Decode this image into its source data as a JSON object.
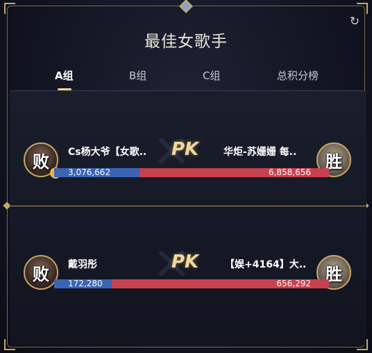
{
  "title": "最佳女歌手",
  "tabs": [
    {
      "label": "A组",
      "active": true
    },
    {
      "label": "B组",
      "active": false
    },
    {
      "label": "C组",
      "active": false
    },
    {
      "label": "总积分榜",
      "active": false
    }
  ],
  "icons": {
    "refresh": "refresh-icon"
  },
  "colors": {
    "accent_gold": "#c9a866",
    "left_bar": "#3b64b5",
    "right_bar": "#c8414e"
  },
  "matches": [
    {
      "left": {
        "name": "Cs杨大爷【女歌..",
        "score": "3,076,662",
        "badge": "败"
      },
      "right": {
        "name": "华炬-苏姗姗 每..",
        "score": "6,858,656",
        "badge": "胜"
      },
      "pk": "PK",
      "left_fraction": 0.31
    },
    {
      "left": {
        "name": "戴羽彤",
        "score": "172,280",
        "badge": "败"
      },
      "right": {
        "name": "【娱+4164】大..",
        "score": "656,292",
        "badge": "胜"
      },
      "pk": "PK",
      "left_fraction": 0.21
    }
  ]
}
